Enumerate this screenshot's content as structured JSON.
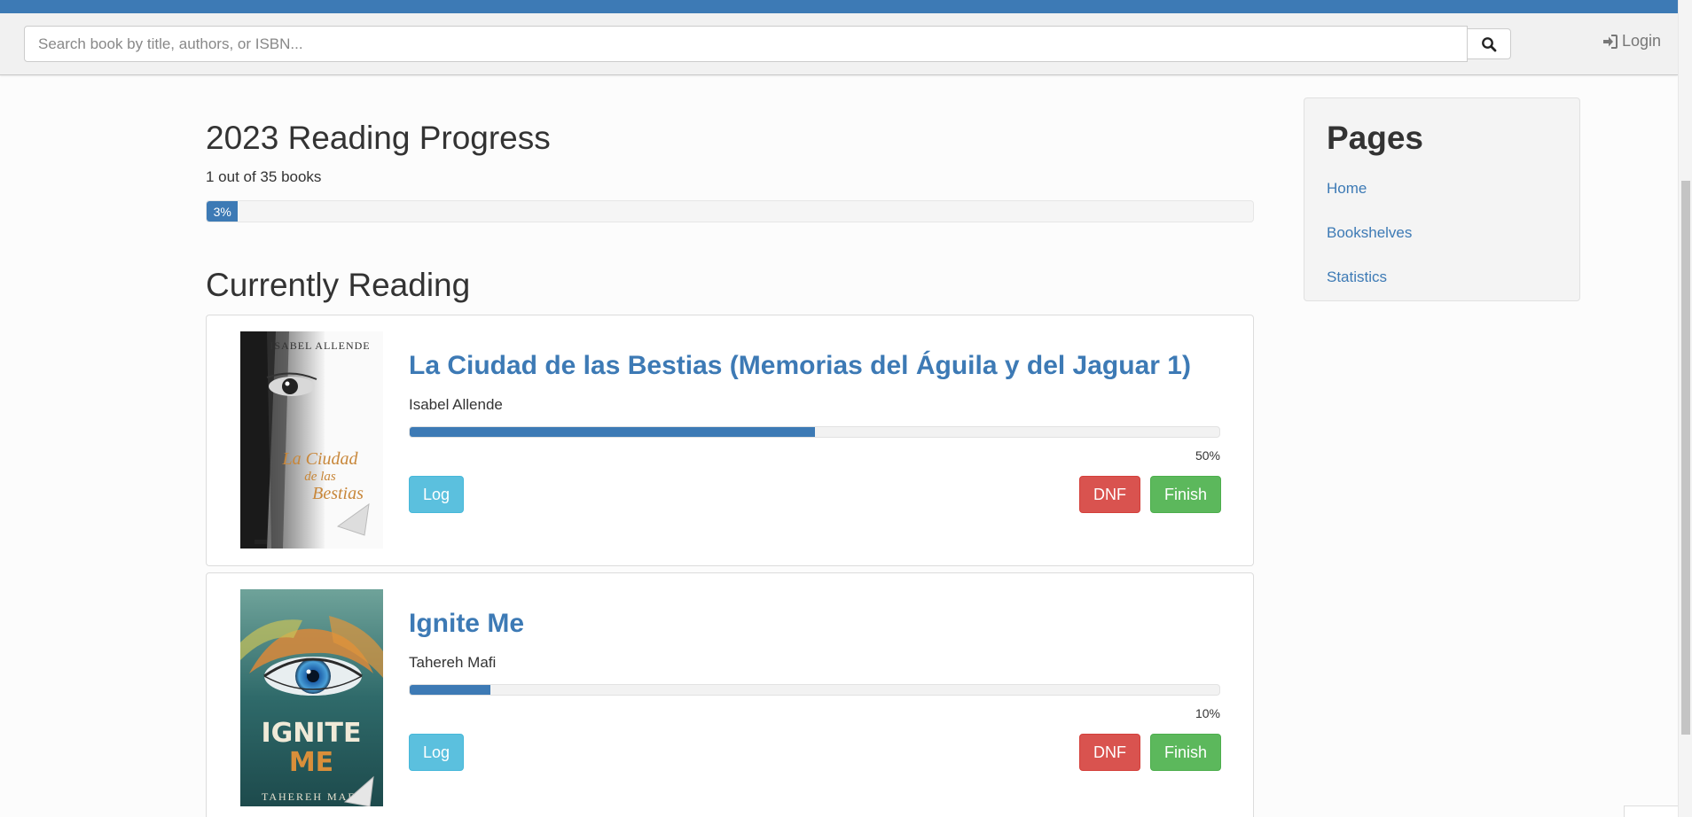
{
  "header": {
    "search_placeholder": "Search book by title, authors, or ISBN...",
    "search_icon": "search-icon",
    "login_label": "Login",
    "login_icon": "sign-in-icon",
    "accent_color": "#3d7ab5"
  },
  "reading_goal": {
    "heading": "2023 Reading Progress",
    "count_text": "1 out of 35 books",
    "percent": 3,
    "percent_label": "3%"
  },
  "current": {
    "heading": "Currently Reading",
    "books": [
      {
        "title": "La Ciudad de las Bestias (Memorias del Águila y del Jaguar 1)",
        "author": "Isabel Allende",
        "progress": 50,
        "progress_label": "50%",
        "cover": {
          "author_text": "ISABEL ALLENDE",
          "line1": "La Ciudad",
          "line2": "de las",
          "line3": "Bestias"
        },
        "log_label": "Log",
        "dnf_label": "DNF",
        "finish_label": "Finish"
      },
      {
        "title": "Ignite Me",
        "author": "Tahereh Mafi",
        "progress": 10,
        "progress_label": "10%",
        "cover": {
          "title_line1": "IGNITE",
          "title_line2": "ME",
          "author_text": "TAHEREH MAFI"
        },
        "log_label": "Log",
        "dnf_label": "DNF",
        "finish_label": "Finish"
      }
    ]
  },
  "sidebar": {
    "title": "Pages",
    "links": [
      "Home",
      "Bookshelves",
      "Statistics"
    ]
  },
  "colors": {
    "log": "#5bc0de",
    "dnf": "#d9534f",
    "finish": "#5cb85c",
    "link": "#3d7ab5"
  }
}
